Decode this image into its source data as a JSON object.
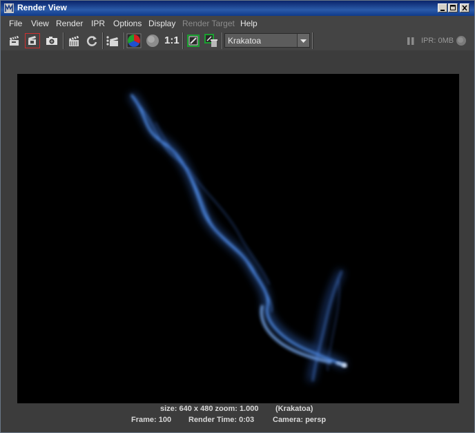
{
  "window": {
    "title": "Render View"
  },
  "menu": {
    "items": [
      "File",
      "View",
      "Render",
      "IPR",
      "Options",
      "Display",
      "Render Target",
      "Help"
    ]
  },
  "toolbar": {
    "ratio_label": "1:1",
    "renderer": "Krakatoa",
    "ipr_status": "IPR: 0MB",
    "icons": [
      "render-clapper-icon",
      "render-region-icon",
      "snapshot-camera-icon",
      "batch-render-icon",
      "refresh-icon",
      "render-sequence-icon",
      "rgb-channels-icon",
      "alpha-channel-icon",
      "real-size-icon",
      "keep-image-icon",
      "remove-image-icon",
      "pause-icon",
      "ipr-status-icon"
    ]
  },
  "status": {
    "size": "size: 640 x 480 zoom: 1.000",
    "renderer": "(Krakatoa)",
    "frame": "Frame: 100",
    "render_time": "Render Time: 0:03",
    "camera": "Camera: persp"
  },
  "colors": {
    "smoke": "#5a9cff",
    "smoke_core": "#cfe4ff",
    "titlebar": "#0a246a"
  }
}
